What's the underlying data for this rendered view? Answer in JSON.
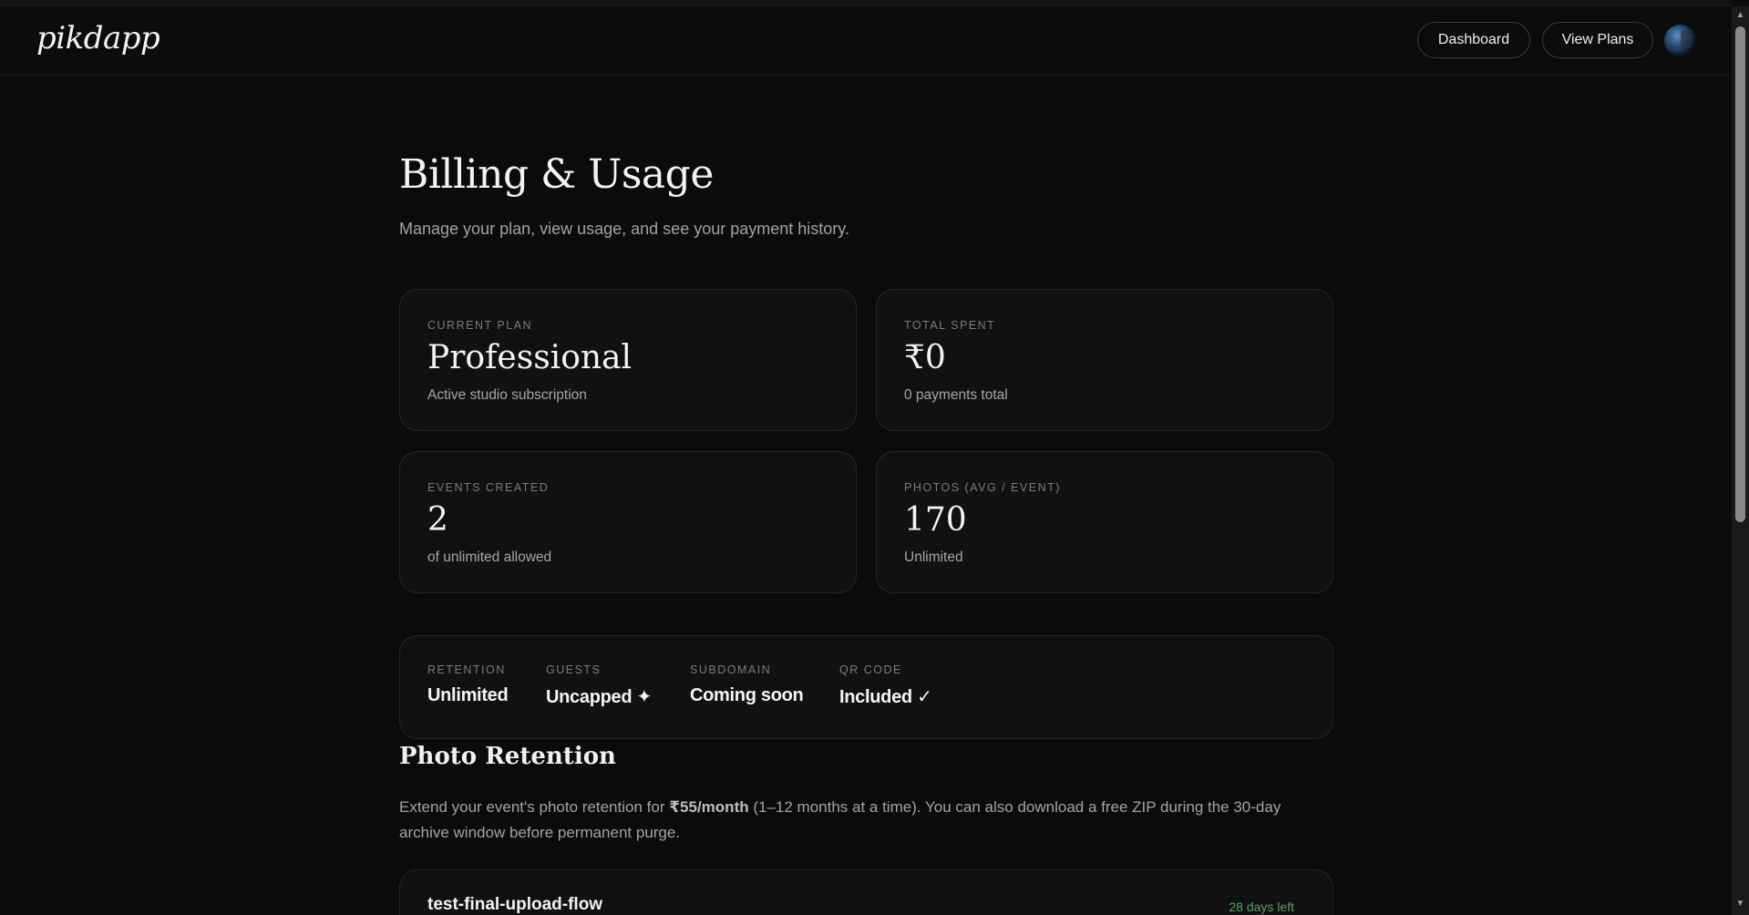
{
  "header": {
    "logo": "pikdapp",
    "nav": {
      "dashboard_label": "Dashboard",
      "view_plans_label": "View Plans"
    },
    "avatar_icon": "user-avatar"
  },
  "page": {
    "title": "Billing & Usage",
    "subtitle": "Manage your plan, view usage, and see your payment history."
  },
  "stats": [
    {
      "label": "CURRENT PLAN",
      "value": "Professional",
      "note": "Active studio subscription"
    },
    {
      "label": "TOTAL SPENT",
      "value": "₹0",
      "note": "0 payments total"
    },
    {
      "label": "EVENTS CREATED",
      "value": "2",
      "note": "of unlimited allowed"
    },
    {
      "label": "PHOTOS (AVG / EVENT)",
      "value": "170",
      "note": "Unlimited"
    }
  ],
  "features": [
    {
      "label": "RETENTION",
      "value": "Unlimited"
    },
    {
      "label": "GUESTS",
      "value": "Uncapped ✦"
    },
    {
      "label": "SUBDOMAIN",
      "value": "Coming soon"
    },
    {
      "label": "QR CODE",
      "value": "Included ✓"
    }
  ],
  "retention": {
    "title": "Photo Retention",
    "text_before": "Extend your event's photo retention for ",
    "price": "₹55/month",
    "text_after": " (1–12 months at a time). You can also download a free ZIP during the 30-day archive window before permanent purge."
  },
  "events": [
    {
      "name": "test-final-upload-flow",
      "days_left": "28 days left"
    }
  ],
  "colors": {
    "background": "#0b0b0b",
    "card": "#111111",
    "border": "#262626",
    "days_left": "#5b9f6a"
  }
}
